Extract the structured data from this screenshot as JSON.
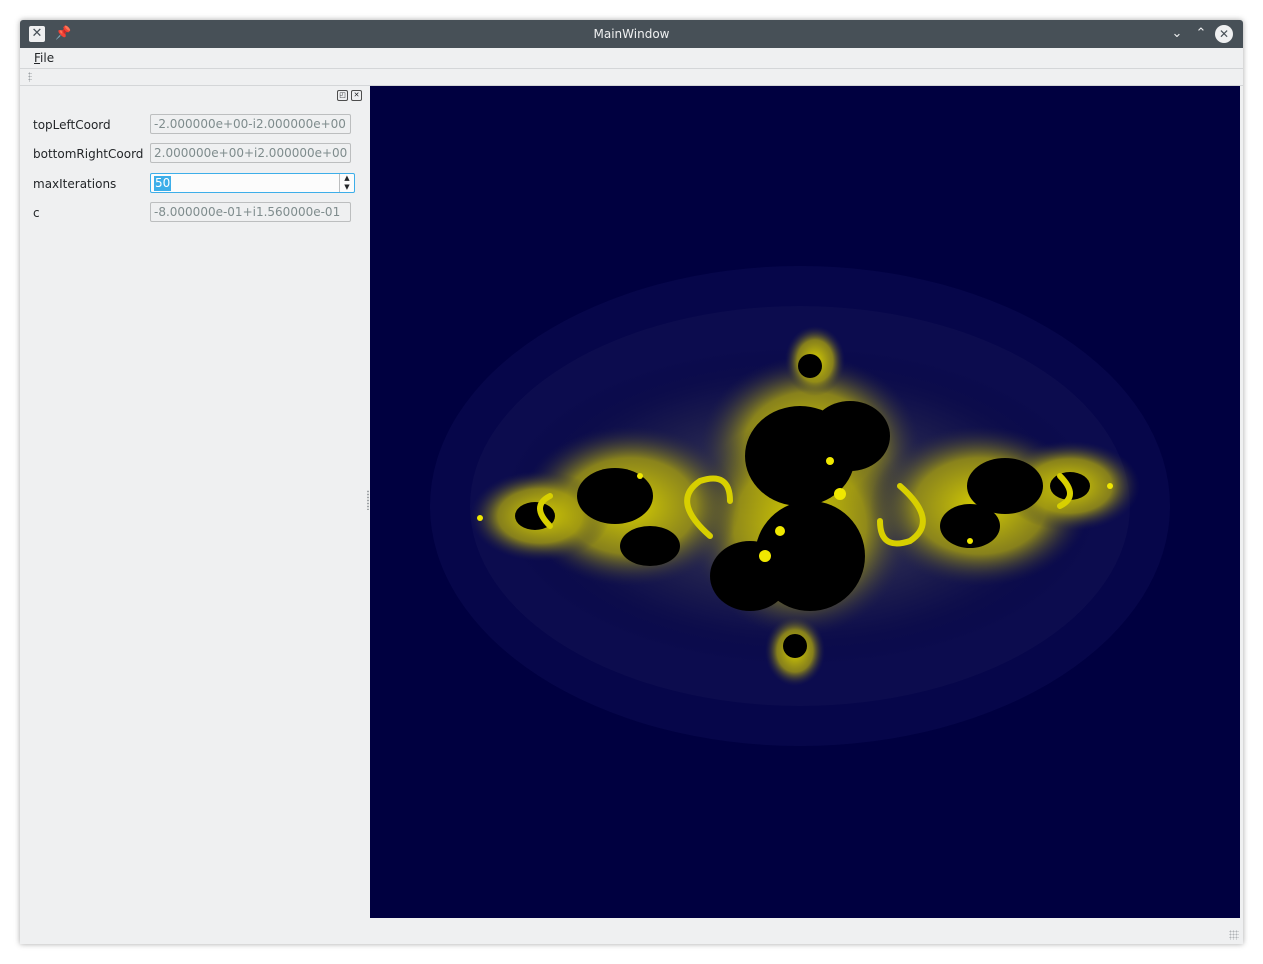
{
  "window": {
    "title": "MainWindow"
  },
  "menubar": {
    "file_rest": "ile",
    "file_mnemonic": "F"
  },
  "form": {
    "top_left": {
      "label": "topLeftCoord",
      "value": "-2.000000e+00-i2.000000e+00"
    },
    "bottom_right": {
      "label": "bottomRightCoord",
      "value": "2.000000e+00+i2.000000e+00"
    },
    "max_iterations": {
      "label": "maxIterations",
      "value": "50"
    },
    "c": {
      "label": "c",
      "value": "-8.000000e-01+i1.560000e-01"
    }
  },
  "fractal": {
    "background_color": "#000040",
    "set_color": "#000000",
    "edge_color": "#d8d000"
  },
  "icons": {
    "app": "x-window-icon",
    "pin": "pin-icon",
    "minimize": "chevron-down-icon",
    "maximize": "chevron-up-icon",
    "close": "close-icon"
  }
}
